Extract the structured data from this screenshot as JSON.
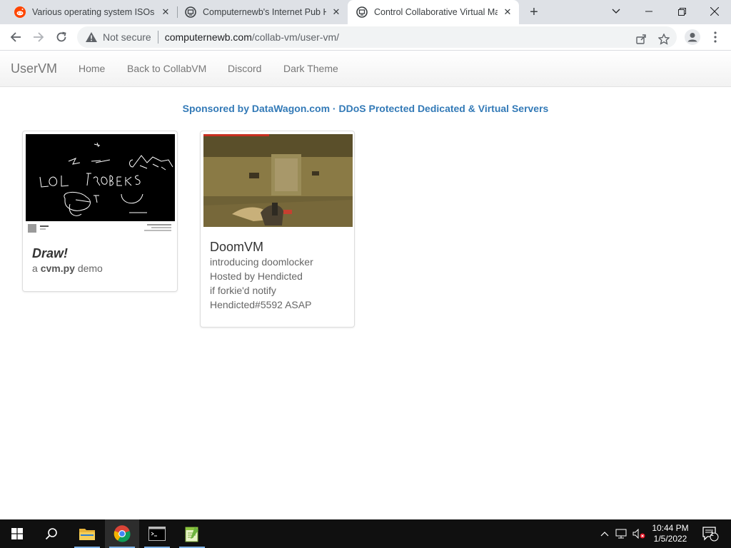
{
  "browser": {
    "tabs": [
      {
        "title": "Various operating system ISOs : d",
        "icon": "reddit-icon",
        "active": false
      },
      {
        "title": "Computernewb's Internet Pub Hu",
        "icon": "collabvm-icon",
        "active": false
      },
      {
        "title": "Control Collaborative Virtual Ma",
        "icon": "collabvm-icon",
        "active": true
      }
    ],
    "security_label": "Not secure",
    "url_host": "computernewb.com",
    "url_path": "/collab-vm/user-vm/"
  },
  "navbar": {
    "brand": "UserVM",
    "links": [
      "Home",
      "Back to CollabVM",
      "Discord",
      "Dark Theme"
    ]
  },
  "sponsor": "Sponsored by DataWagon.com · DDoS Protected Dedicated & Virtual Servers",
  "vms": [
    {
      "title": "Draw!",
      "desc_prefix": "a ",
      "desc_bold": "cvm.py",
      "desc_suffix": " demo"
    },
    {
      "title": "DoomVM",
      "lines": [
        "introducing doomlocker",
        "Hosted by Hendicted",
        "if forkie'd notify",
        "Hendicted#5592 ASAP"
      ]
    }
  ],
  "taskbar": {
    "time": "10:44 PM",
    "date": "1/5/2022",
    "notification_count": "1"
  },
  "colors": {
    "link_blue": "#337ab7",
    "navbar_text": "#777777",
    "taskbar_bg": "#101010"
  }
}
